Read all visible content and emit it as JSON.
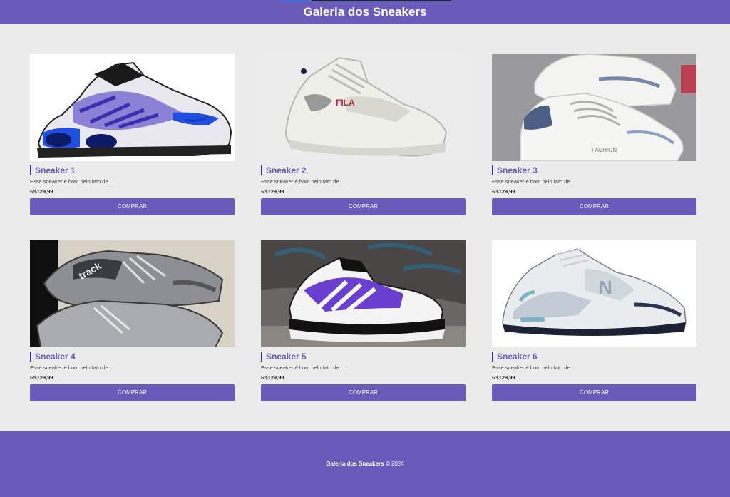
{
  "header": {
    "title": "Galeria dos Sneakers"
  },
  "products": [
    {
      "name": "Sneaker 1",
      "description": "Esse sneaker é bom pelo fato de ...",
      "currency": "R$",
      "price": "129,99",
      "button": "COMPRAR",
      "image_icon": "sneaker-1-image"
    },
    {
      "name": "Sneaker 2",
      "description": "Esse sneaker é bom pelo fato de ...",
      "currency": "R$",
      "price": "129,99",
      "button": "COMPRAR",
      "image_icon": "sneaker-2-image"
    },
    {
      "name": "Sneaker 3",
      "description": "Esse sneaker é bom pelo fato de ...",
      "currency": "R$",
      "price": "129,99",
      "button": "COMPRAR",
      "image_icon": "sneaker-3-image"
    },
    {
      "name": "Sneaker 4",
      "description": "Esse sneaker é bom pelo fato de ...",
      "currency": "R$",
      "price": "129,99",
      "button": "COMPRAR",
      "image_icon": "sneaker-4-image"
    },
    {
      "name": "Sneaker 5",
      "description": "Esse sneaker é bom pelo fato de ...",
      "currency": "R$",
      "price": "129,99",
      "button": "COMPRAR",
      "image_icon": "sneaker-5-image"
    },
    {
      "name": "Sneaker 6",
      "description": "Esse sneaker é bom pelo fato de ...",
      "currency": "R$",
      "price": "129,99",
      "button": "COMPRAR",
      "image_icon": "sneaker-6-image"
    }
  ],
  "footer": {
    "brand": "Galeria dos Sneakers",
    "suffix": "© 2024"
  },
  "colors": {
    "brand": "#6a5ab9",
    "background": "#ebebeb",
    "accent_border": "#3a2f8f"
  }
}
